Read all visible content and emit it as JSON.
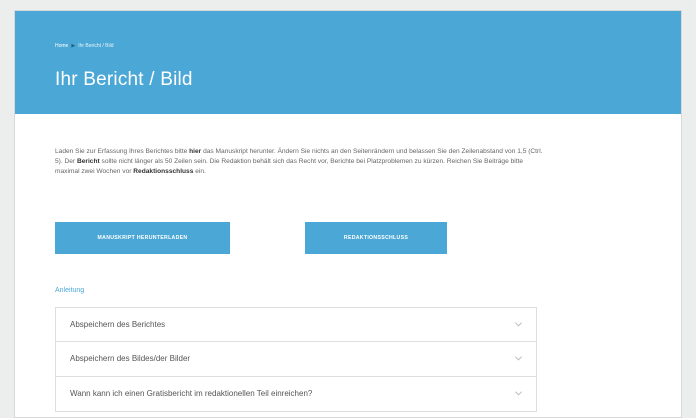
{
  "breadcrumb": {
    "home": "Home",
    "current": "Ihr Bericht / Bild"
  },
  "header": {
    "title": "Ihr Bericht / Bild",
    "background_color": "#4ba7d6"
  },
  "intro": {
    "part1": "Laden Sie zur Erfassung Ihres Berichtes bitte ",
    "bold1": "hier",
    "part2": " das Manuskript herunter. Ändern Sie nichts an den Seitenrändern und belassen Sie den Zeilenabstand von 1,5 (Ctrl. 5). Der ",
    "bold2": "Bericht",
    "part3": " sollte nicht länger als 50 Zeilen sein. Die Redaktion behält sich das Recht vor, Berichte bei Platzproblemen zu kürzen. Reichen Sie Beiträge bitte maximal zwei Wochen vor ",
    "bold3": "Redaktionsschluss",
    "part4": " ein."
  },
  "buttons": {
    "download_label": "MANUSKRIPT HERUNTERLADEN",
    "deadline_label": "REDAKTIONSSCHLUSS"
  },
  "section_label": "Anleitung",
  "accordion": {
    "items": [
      {
        "label": "Abspeichern des Berichtes",
        "icon": "chevron-down-icon"
      },
      {
        "label": "Abspeichern des Bildes/der Bilder",
        "icon": "chevron-down-icon"
      },
      {
        "label": "Wann kann ich einen Gratisbericht im redaktionellen Teil einreichen?",
        "icon": "chevron-down-icon"
      }
    ]
  }
}
